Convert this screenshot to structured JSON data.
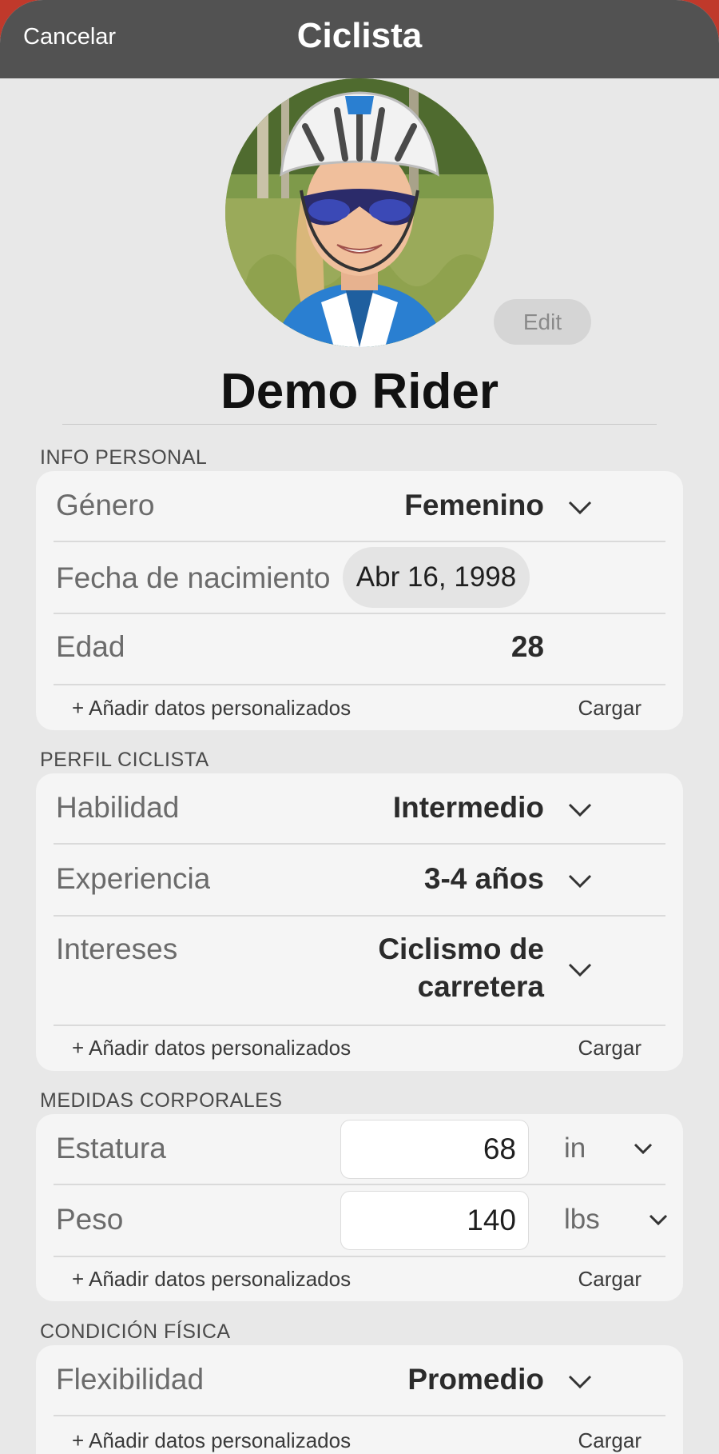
{
  "nav": {
    "cancel": "Cancelar",
    "title": "Ciclista"
  },
  "profile": {
    "edit_label": "Edit",
    "name": "Demo Rider"
  },
  "personal": {
    "header": "INFO PERSONAL",
    "gender_label": "Género",
    "gender_value": "Femenino",
    "dob_label": "Fecha de nacimiento",
    "dob_value": "Abr 16, 1998",
    "age_label": "Edad",
    "age_value": "28",
    "add_label": "+ Añadir datos personalizados",
    "load_label": "Cargar"
  },
  "cycling": {
    "header": "PERFIL CICLISTA",
    "skill_label": "Habilidad",
    "skill_value": "Intermedio",
    "experience_label": "Experiencia",
    "experience_value": "3-4 años",
    "interests_label": "Intereses",
    "interests_value_line1": "Ciclismo de",
    "interests_value_line2": "carretera",
    "add_label": "+ Añadir datos personalizados",
    "load_label": "Cargar"
  },
  "body": {
    "header": "MEDIDAS CORPORALES",
    "height_label": "Estatura",
    "height_value": "68",
    "height_unit": "in",
    "weight_label": "Peso",
    "weight_value": "140",
    "weight_unit": "lbs",
    "add_label": "+ Añadir datos personalizados",
    "load_label": "Cargar"
  },
  "fitness": {
    "header": "CONDICIÓN FÍSICA",
    "flex_label": "Flexibilidad",
    "flex_value": "Promedio",
    "add_label": "+ Añadir datos personalizados",
    "load_label": "Cargar"
  },
  "colors": {
    "nav": "#525252",
    "background": "#e8e8e8",
    "card": "#f5f5f5",
    "jersey": "#2a7fd1"
  }
}
